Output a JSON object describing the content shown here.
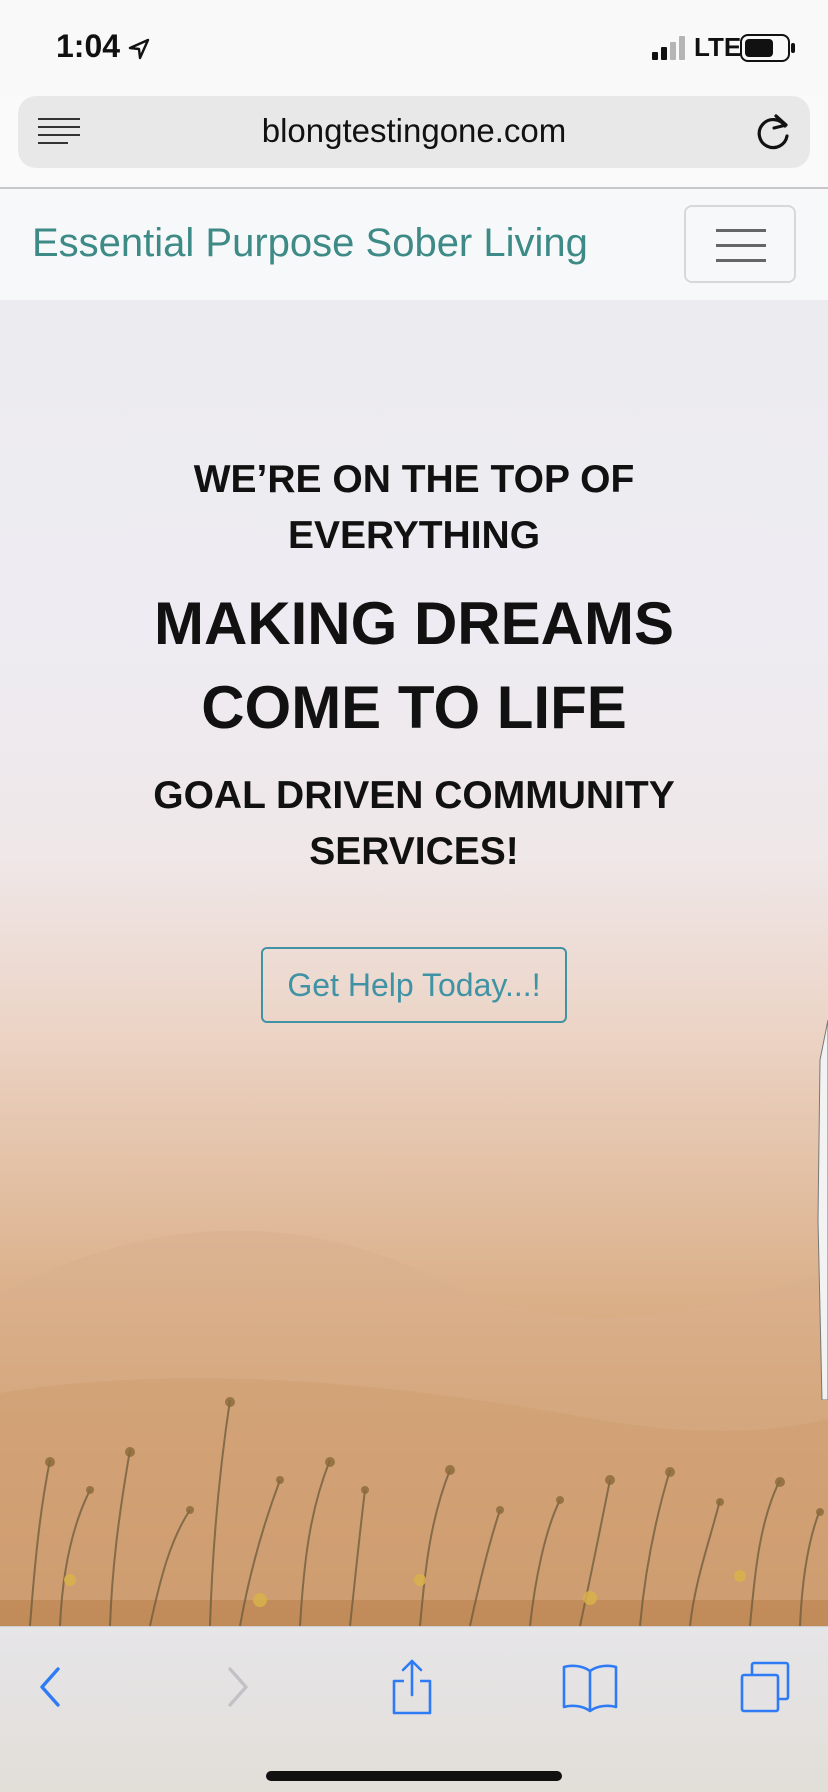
{
  "status_bar": {
    "time": "1:04",
    "network": "LTE",
    "icons": [
      "location-arrow-icon",
      "signal-bars-icon",
      "battery-icon"
    ]
  },
  "browser": {
    "url": "blongtestingone.com",
    "icons": [
      "reader-view-icon",
      "reload-icon"
    ]
  },
  "site": {
    "brand": "Essential Purpose Sober Living",
    "brand_color": "#3d8a86",
    "menu_icon": "hamburger-menu-icon"
  },
  "hero": {
    "pretitle": "WE’RE ON THE TOP OF EVERYTHING",
    "title": "MAKING DREAMS COME TO LIFE",
    "subtitle": "GOAL DRIVEN COMMUNITY SERVICES!",
    "cta_label": "Get Help Today...!",
    "cta_color": "#3f93a4"
  },
  "toolbar": {
    "icons": [
      "back-chevron-icon",
      "forward-chevron-icon",
      "share-icon",
      "bookmarks-icon",
      "tabs-icon"
    ],
    "accent_color": "#2f7bf6"
  }
}
